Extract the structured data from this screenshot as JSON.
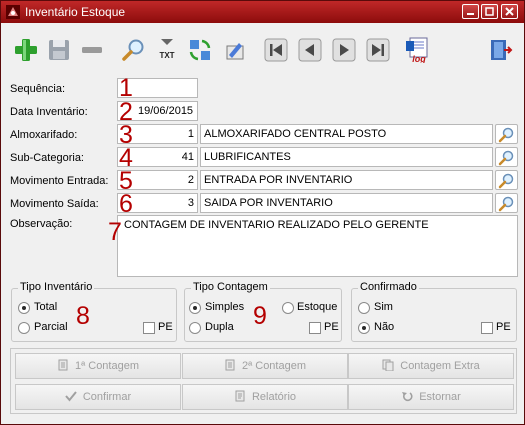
{
  "window": {
    "title": "Inventário Estoque"
  },
  "form": {
    "sequencia_label": "Sequência:",
    "data_label": "Data Inventário:",
    "data_value": "19/06/2015",
    "almox_label": "Almoxarifado:",
    "almox_code": "1",
    "almox_name": "ALMOXARIFADO CENTRAL POSTO",
    "subcat_label": "Sub-Categoria:",
    "subcat_code": "41",
    "subcat_name": "LUBRIFICANTES",
    "mov_entrada_label": "Movimento Entrada:",
    "mov_entrada_code": "2",
    "mov_entrada_name": "ENTRADA POR INVENTARIO",
    "mov_saida_label": "Movimento Saída:",
    "mov_saida_code": "3",
    "mov_saida_name": "SAIDA POR INVENTARIO",
    "obs_label": "Observação:",
    "obs_value": "CONTAGEM DE INVENTARIO REALIZADO PELO GERENTE"
  },
  "annotations": [
    "1",
    "2",
    "3",
    "4",
    "5",
    "6",
    "7",
    "8",
    "9"
  ],
  "groups": {
    "tipo_inventario": {
      "title": "Tipo Inventário",
      "opt1": "Total",
      "opt2": "Parcial",
      "pe": "PE"
    },
    "tipo_contagem": {
      "title": "Tipo Contagem",
      "opt1": "Simples",
      "opt2": "Dupla",
      "opt3": "Estoque",
      "pe": "PE"
    },
    "confirmado": {
      "title": "Confirmado",
      "opt1": "Sim",
      "opt2": "Não",
      "pe": "PE"
    }
  },
  "actions": {
    "contagem1": "1ª Contagem",
    "contagem2": "2ª Contagem",
    "contagem_extra": "Contagem Extra",
    "confirmar": "Confirmar",
    "relatorio": "Relatório",
    "estornar": "Estornar"
  },
  "toolbar_icons": [
    "add-icon",
    "save-icon",
    "remove-icon",
    "search-icon",
    "txt-export-icon",
    "refresh-icon",
    "edit-icon",
    "first-record-icon",
    "previous-record-icon",
    "next-record-icon",
    "last-record-icon",
    "log-icon",
    "exit-icon"
  ],
  "toolbar_labels": {
    "txt": "TXT",
    "log": "log"
  },
  "colors": {
    "title_bar": "#a21c1c",
    "annotation": "#b40000",
    "add": "#2ea02e"
  }
}
